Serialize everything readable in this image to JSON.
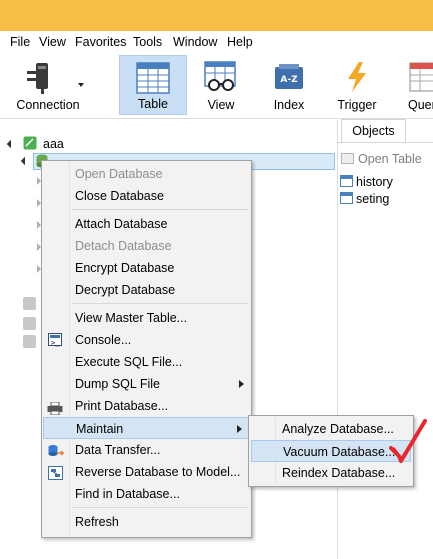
{
  "menubar": {
    "items": [
      "File",
      "View",
      "Favorites",
      "Tools",
      "Window",
      "Help"
    ]
  },
  "toolbar": {
    "buttons": [
      {
        "label": "Connection",
        "icon": "plug-icon",
        "active": false
      },
      {
        "label": "Table",
        "icon": "table-icon",
        "active": true
      },
      {
        "label": "View",
        "icon": "glasses-table-icon",
        "active": false
      },
      {
        "label": "Index",
        "icon": "index-az-icon",
        "active": false
      },
      {
        "label": "Trigger",
        "icon": "lightning-icon",
        "active": false
      },
      {
        "label": "Quer",
        "icon": "query-icon",
        "active": false
      }
    ]
  },
  "tree": {
    "connection_name": "aaa"
  },
  "objects": {
    "tab_label": "Objects",
    "open_table_label": "Open Table",
    "tables": [
      "history",
      "seting"
    ]
  },
  "context_menu": {
    "items": [
      {
        "label": "Open Database",
        "disabled": true
      },
      {
        "label": "Close Database",
        "disabled": false
      },
      {
        "label": "Attach Database",
        "disabled": false
      },
      {
        "label": "Detach Database",
        "disabled": true
      },
      {
        "label": "Encrypt Database",
        "disabled": false
      },
      {
        "label": "Decrypt Database",
        "disabled": false
      },
      {
        "label": "View Master Table...",
        "disabled": false
      },
      {
        "label": "Console...",
        "disabled": false,
        "icon": "console-icon"
      },
      {
        "label": "Execute SQL File...",
        "disabled": false
      },
      {
        "label": "Dump SQL File",
        "disabled": false,
        "submenu": true
      },
      {
        "label": "Print Database...",
        "disabled": false,
        "icon": "printer-icon"
      },
      {
        "label": "Maintain",
        "disabled": false,
        "submenu": true,
        "highlighted": true
      },
      {
        "label": "Data Transfer...",
        "disabled": false,
        "icon": "data-transfer-icon"
      },
      {
        "label": "Reverse Database to Model...",
        "disabled": false,
        "icon": "reverse-model-icon"
      },
      {
        "label": "Find in Database...",
        "disabled": false
      },
      {
        "label": "Refresh",
        "disabled": false
      }
    ]
  },
  "maintain_submenu": {
    "items": [
      {
        "label": "Analyze Database...",
        "highlighted": false
      },
      {
        "label": "Vacuum Database...",
        "highlighted": true
      },
      {
        "label": "Reindex Database...",
        "highlighted": false
      }
    ]
  },
  "colors": {
    "titlebar": "#f7bd45",
    "highlight": "#d5e4f5",
    "highlight_border": "#a9c8ec",
    "checkmark": "#e8262b"
  }
}
